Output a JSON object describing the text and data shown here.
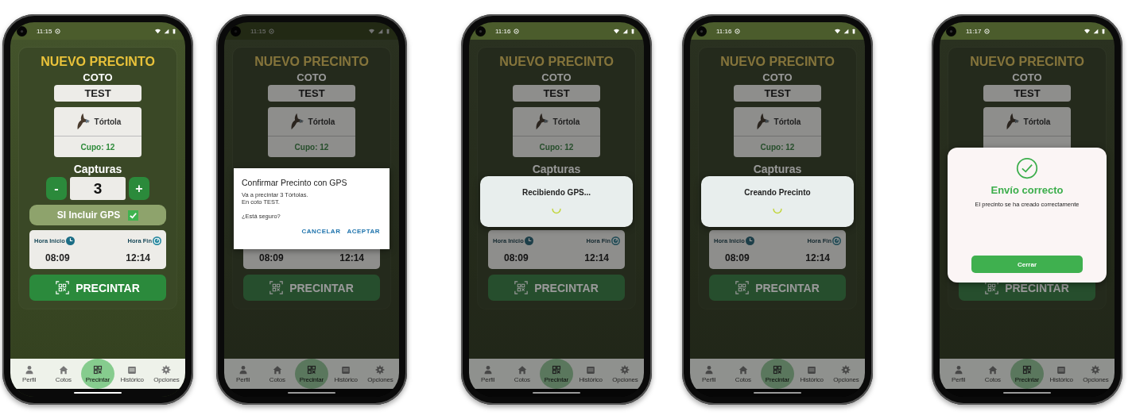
{
  "phones": [
    {
      "status_bar": {
        "time": "11:15",
        "dimmed": false
      },
      "screen": {
        "dimmed": false,
        "title": "NUEVO PRECINTO",
        "coto_label": "COTO",
        "coto": "TEST",
        "species": "Tórtola",
        "quota": "Cupo: 12",
        "captures_label": "Capturas",
        "counter": {
          "minus": "-",
          "value": "3",
          "plus": "+"
        },
        "gps": {
          "label": "SI Incluir GPS",
          "checked": true
        },
        "hours": {
          "start_label": "Hora Inicio",
          "end_label": "Hora Fin",
          "start": "08:09",
          "end": "12:14"
        },
        "seal_button": "PRECINTAR"
      },
      "nav": [
        {
          "label": "Perfil",
          "selected": false
        },
        {
          "label": "Cotos",
          "selected": false
        },
        {
          "label": "Precintar",
          "selected": true
        },
        {
          "label": "Histórico",
          "selected": false
        },
        {
          "label": "Opciones",
          "selected": false
        }
      ]
    },
    {
      "status_bar": {
        "time": "11:15",
        "dimmed": true
      },
      "screen": {
        "dimmed": true,
        "title": "NUEVO PRECINTO",
        "coto_label": "COTO",
        "coto": "TEST",
        "species": "Tórtola",
        "quota": "Cupo: 12",
        "hours": {
          "start": "08:09",
          "end": "12:14"
        },
        "seal_button": "PRECINTAR"
      },
      "nav": [
        {
          "label": "Perfil",
          "selected": false
        },
        {
          "label": "Cotos",
          "selected": false
        },
        {
          "label": "Precintar",
          "selected": true
        },
        {
          "label": "Histórico",
          "selected": false
        },
        {
          "label": "Opciones",
          "selected": false
        }
      ],
      "dialog": {
        "kind": "confirm",
        "title": "Confirmar Precinto con GPS",
        "message": [
          "Va a precintar 3 Tórtolas.",
          "En coto TEST."
        ],
        "question": "¿Está seguro?",
        "actions": [
          "CANCELAR",
          "ACEPTAR"
        ]
      }
    },
    {
      "status_bar": {
        "time": "11:16",
        "dimmed": false
      },
      "screen": {
        "dimmed": true,
        "title": "NUEVO PRECINTO",
        "coto_label": "COTO",
        "coto": "TEST",
        "species": "Tórtola",
        "quota": "Cupo: 12",
        "captures_label": "Capturas",
        "hours": {
          "start_label": "Hora Inicio",
          "end_label": "Hora Fin",
          "start": "08:09",
          "end": "12:14"
        },
        "seal_button": "PRECINTAR"
      },
      "nav": [
        {
          "label": "Perfil",
          "selected": false
        },
        {
          "label": "Cotos",
          "selected": false
        },
        {
          "label": "Precintar",
          "selected": true
        },
        {
          "label": "Histórico",
          "selected": false
        },
        {
          "label": "Opciones",
          "selected": false
        }
      ],
      "dialog": {
        "kind": "loading",
        "message": "Recibiendo GPS..."
      }
    },
    {
      "status_bar": {
        "time": "11:16",
        "dimmed": false
      },
      "screen": {
        "dimmed": true,
        "title": "NUEVO PRECINTO",
        "coto_label": "COTO",
        "coto": "TEST",
        "species": "Tórtola",
        "quota": "Cupo: 12",
        "captures_label": "Capturas",
        "hours": {
          "start_label": "Hora Inicio",
          "end_label": "Hora Fin",
          "start": "08:09",
          "end": "12:14"
        },
        "seal_button": "PRECINTAR"
      },
      "nav": [
        {
          "label": "Perfil",
          "selected": false
        },
        {
          "label": "Cotos",
          "selected": false
        },
        {
          "label": "Precintar",
          "selected": true
        },
        {
          "label": "Histórico",
          "selected": false
        },
        {
          "label": "Opciones",
          "selected": false
        }
      ],
      "dialog": {
        "kind": "loading",
        "message": "Creando Precinto"
      }
    },
    {
      "status_bar": {
        "time": "11:17",
        "dimmed": false
      },
      "screen": {
        "dimmed": true,
        "title": "NUEVO PRECINTO",
        "coto_label": "COTO",
        "coto": "TEST",
        "species": "Tórtola",
        "seal_button": "PRECINTAR"
      },
      "nav": [
        {
          "label": "Perfil",
          "selected": false
        },
        {
          "label": "Cotos",
          "selected": false
        },
        {
          "label": "Precintar",
          "selected": true
        },
        {
          "label": "Histórico",
          "selected": false
        },
        {
          "label": "Opciones",
          "selected": false
        }
      ],
      "dialog": {
        "kind": "success",
        "title": "Envío correcto",
        "message": "El precinto se ha creado correctamente",
        "button": "Cerrar"
      }
    }
  ]
}
